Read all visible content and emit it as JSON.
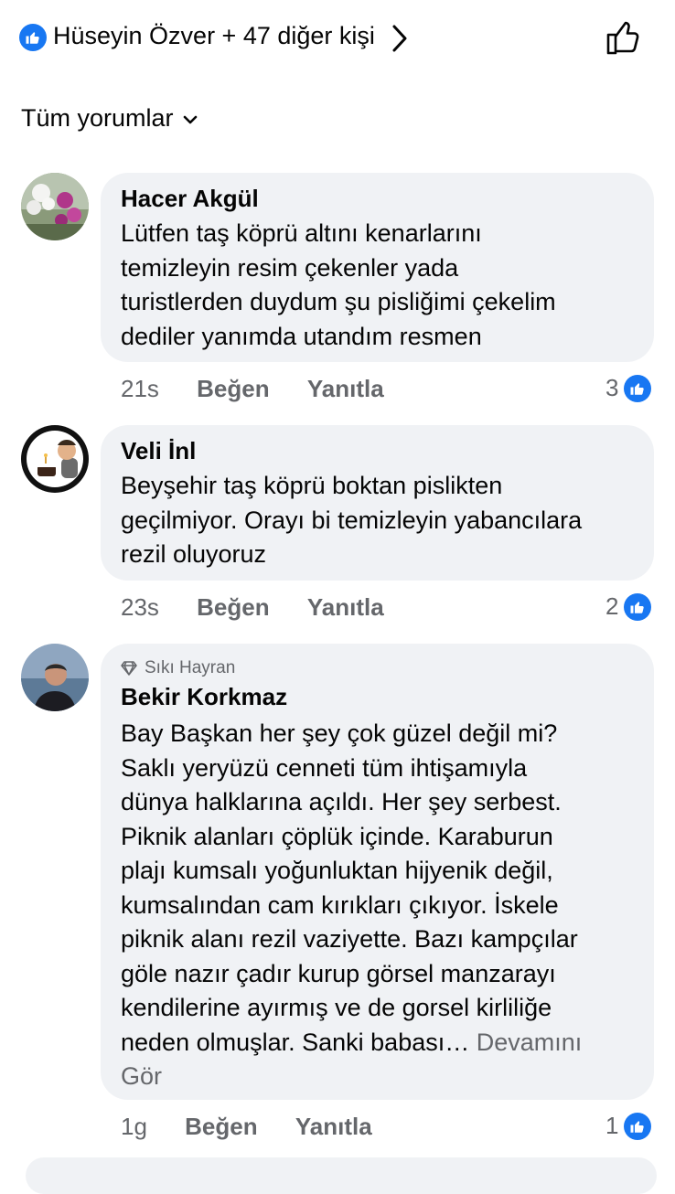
{
  "reactions": {
    "summary": "Hüseyin Özver + 47 diğer kişi"
  },
  "filter": {
    "label": "Tüm yorumlar"
  },
  "comments": [
    {
      "author": "Hacer Akgül",
      "text": "Lütfen taş köprü altını kenarlarını\ntemizleyin resim çekenler yada\nturistlerden duydum şu pisliğimi çekelim\ndediler yanımda utandım resmen",
      "time": "21s",
      "like_label": "Beğen",
      "reply_label": "Yanıtla",
      "reaction_count": "3"
    },
    {
      "author": "Veli İnl",
      "text": "Beyşehir taş köprü boktan pislikten\ngeçilmiyor. Orayı bi temizleyin yabancılara\nrezil oluyoruz",
      "time": "23s",
      "like_label": "Beğen",
      "reply_label": "Yanıtla",
      "reaction_count": "2"
    },
    {
      "badge": "Sıkı Hayran",
      "author": "Bekir Korkmaz",
      "text": "Bay Başkan her şey çok güzel değil mi?\nSaklı yeryüzü cenneti tüm ihtişamıyla\ndünya halklarına açıldı. Her şey serbest.\nPiknik alanları çöplük içinde. Karaburun\nplajı kumsalı yoğunluktan hijyenik değil,\nkumsalından cam kırıkları çıkıyor. İskele\npiknik alanı rezil vaziyette. Bazı kampçılar\ngöle nazır çadır kurup görsel manzarayı\nkendilerine ayırmış ve de gorsel kirliliğe\nneden olmuşlar. Sanki babası…",
      "see_more": " Devamını\nGör",
      "time": "1g",
      "like_label": "Beğen",
      "reply_label": "Yanıtla",
      "reaction_count": "1"
    }
  ],
  "colors": {
    "accent": "#1877f2",
    "bubble": "#f0f2f5",
    "meta": "#65676b"
  }
}
